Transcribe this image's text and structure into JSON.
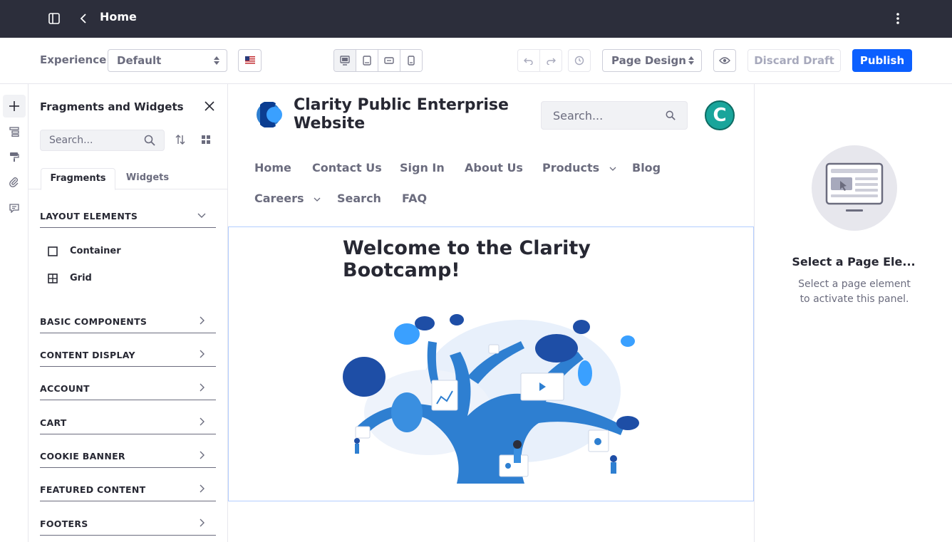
{
  "topbar": {
    "title": "Home",
    "sidebar_icon": "sidebar-toggle-icon",
    "back_icon": "chevron-left-icon",
    "menu_icon": "ellipsis-vertical-icon"
  },
  "toolbar": {
    "experience_label": "Experience",
    "experience_value": "Default",
    "language": "en-US flag",
    "devices": [
      "desktop",
      "tablet",
      "landscape",
      "portrait"
    ],
    "view_mode": "Page Design",
    "discard_label": "Discard Draft",
    "publish_label": "Publish"
  },
  "rail": [
    "plus-icon",
    "page-structure-icon",
    "paint-brush-icon",
    "paperclip-icon",
    "comments-icon"
  ],
  "fragments_panel": {
    "title": "Fragments and Widgets",
    "search_placeholder": "Search...",
    "tabs": [
      "Fragments",
      "Widgets"
    ],
    "layout_elements": {
      "label": "LAYOUT ELEMENTS",
      "items": [
        "Container",
        "Grid"
      ]
    },
    "categories": [
      "BASIC COMPONENTS",
      "CONTENT DISPLAY",
      "ACCOUNT",
      "CART",
      "COOKIE BANNER",
      "FEATURED CONTENT",
      "FOOTERS"
    ]
  },
  "site": {
    "name": "Clarity Public Enterprise Website",
    "search_placeholder": "Search...",
    "avatar_initial": "C",
    "nav_row1": [
      "Home",
      "Contact Us",
      "Sign In",
      "About Us",
      "Products",
      "Blog"
    ],
    "nav_row2": [
      "Careers",
      "Search",
      "FAQ"
    ],
    "hero_title": "Welcome to the Clarity Bootcamp!"
  },
  "right_panel": {
    "title": "Select a Page Ele...",
    "description": "Select a page element to activate this panel."
  },
  "colors": {
    "topbar": "#2c2e3b",
    "primary": "#0b5fff",
    "brand_teal": "#19a59b",
    "tree_blue": "#2e7fd1"
  }
}
